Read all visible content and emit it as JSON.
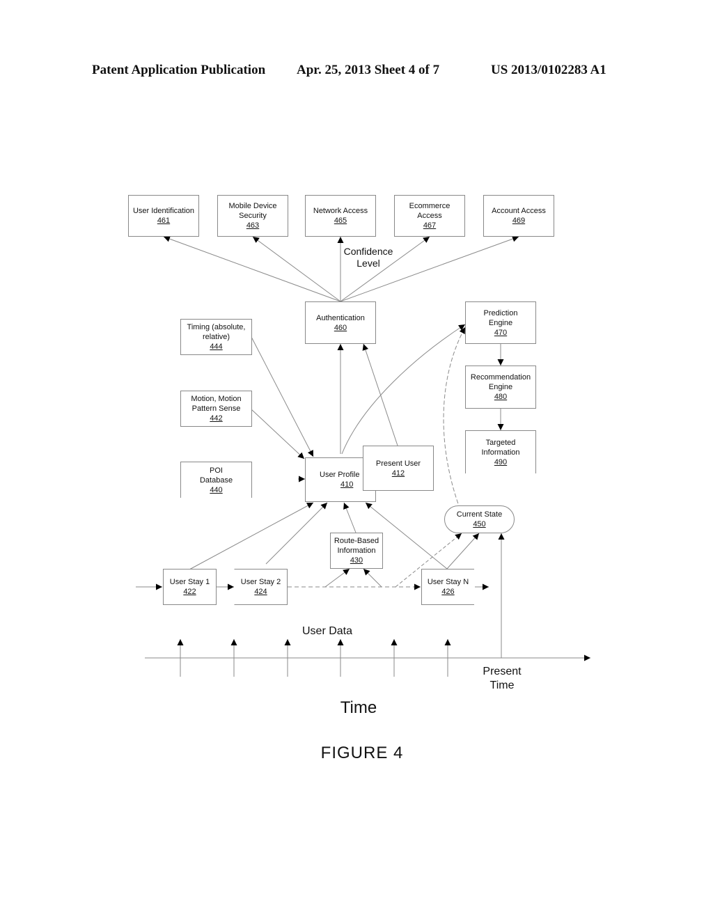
{
  "header": {
    "left": "Patent Application Publication",
    "center": "Apr. 25, 2013  Sheet 4 of 7",
    "right": "US 2013/0102283 A1"
  },
  "boxes": {
    "b461": {
      "label": "User Identification",
      "num": "461"
    },
    "b463": {
      "label": "Mobile Device Security",
      "num": "463"
    },
    "b465": {
      "label": "Network Access",
      "num": "465"
    },
    "b467": {
      "label": "Ecommerce Access",
      "num": "467"
    },
    "b469": {
      "label": "Account Access",
      "num": "469"
    },
    "b460": {
      "label": "Authentication",
      "num": "460"
    },
    "b444": {
      "label": "Timing (absolute, relative)",
      "num": "444"
    },
    "b442": {
      "label": "Motion, Motion Pattern Sense",
      "num": "442"
    },
    "b440": {
      "label": "POI Database",
      "num": "440"
    },
    "b410": {
      "label": "User Profile",
      "num": "410"
    },
    "b412": {
      "label": "Present User",
      "num": "412"
    },
    "b470": {
      "label": "Prediction Engine",
      "num": "470"
    },
    "b480": {
      "label": "Recommendation Engine",
      "num": "480"
    },
    "b490": {
      "label": "Targeted Information",
      "num": "490"
    },
    "b450": {
      "label": "Current State",
      "num": "450"
    },
    "b430": {
      "label": "Route-Based Information",
      "num": "430"
    },
    "b422": {
      "label": "User Stay 1",
      "num": "422"
    },
    "b424": {
      "label": "User Stay 2",
      "num": "424"
    },
    "b426": {
      "label": "User Stay N",
      "num": "426"
    }
  },
  "labels": {
    "confidence": "Confidence Level",
    "user_data": "User Data",
    "present_time": "Present Time",
    "time": "Time",
    "figure": "FIGURE  4"
  }
}
